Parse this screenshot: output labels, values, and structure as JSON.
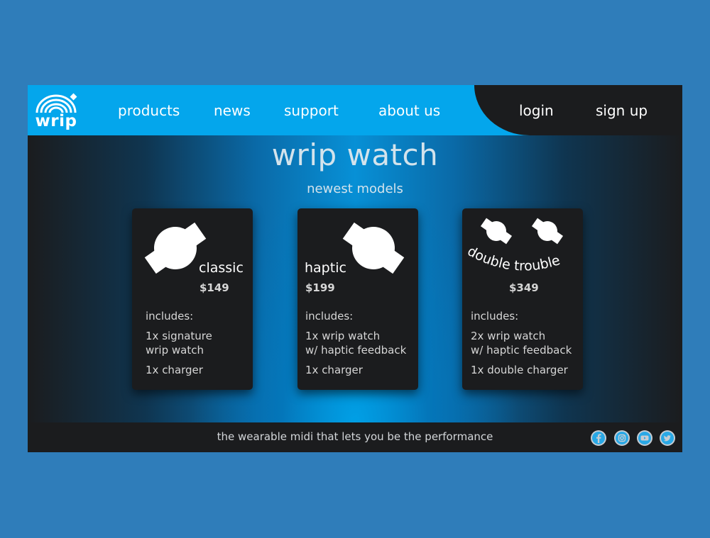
{
  "brand": {
    "logo_text": "wrip"
  },
  "nav": {
    "items": [
      {
        "label": "products"
      },
      {
        "label": "news"
      },
      {
        "label": "support"
      },
      {
        "label": "about us"
      }
    ],
    "login": "login",
    "signup": "sign up"
  },
  "hero": {
    "title": "wrip watch",
    "subtitle": "newest models"
  },
  "cards": [
    {
      "name": "classic",
      "price": "$149",
      "includes_label": "includes:",
      "items": [
        "1x signature",
        "wrip watch",
        "1x charger"
      ]
    },
    {
      "name": "haptic",
      "price": "$199",
      "includes_label": "includes:",
      "items": [
        "1x wrip watch",
        "w/ haptic feedback",
        "1x charger"
      ]
    },
    {
      "name": "double trouble",
      "price": "$349",
      "includes_label": "includes:",
      "items": [
        "2x wrip watch",
        "w/ haptic feedback",
        "1x double charger"
      ]
    }
  ],
  "footer": {
    "tagline": "the wearable midi that lets you be the performance",
    "social": [
      "facebook-icon",
      "instagram-icon",
      "youtube-icon",
      "twitter-icon"
    ]
  },
  "colors": {
    "background": "#2f7dba",
    "nav_blue": "#04a6ec",
    "dark": "#1b1c1e",
    "accent_glow": "#0790d6",
    "social_icon": "#29a8e6"
  }
}
